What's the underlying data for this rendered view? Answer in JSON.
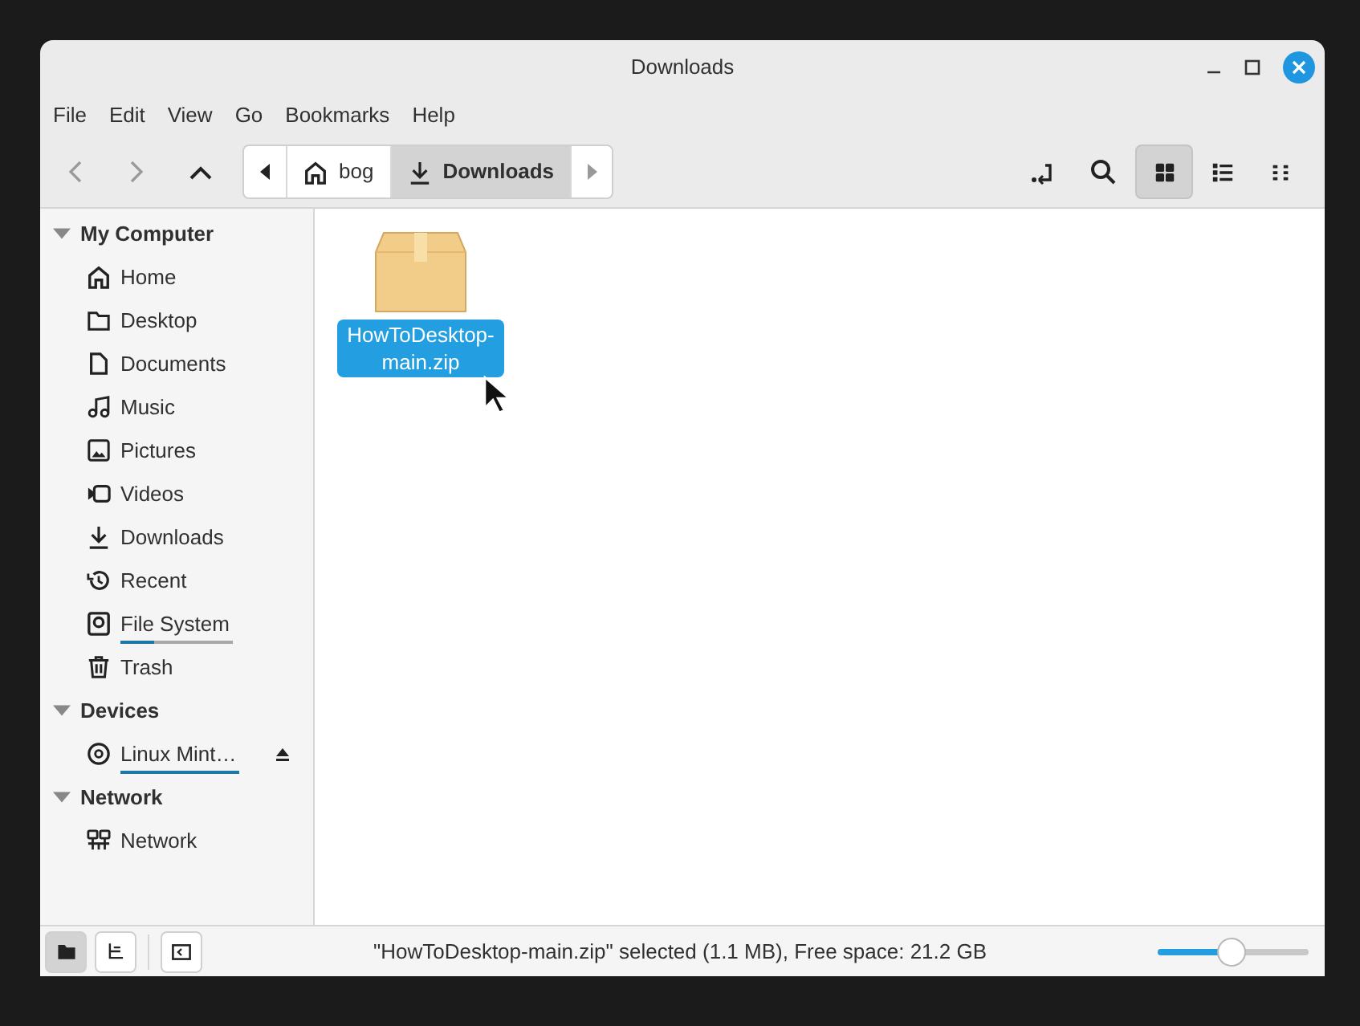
{
  "window": {
    "title": "Downloads"
  },
  "menu": [
    "File",
    "Edit",
    "View",
    "Go",
    "Bookmarks",
    "Help"
  ],
  "breadcrumbs": [
    {
      "label": "bog",
      "kind": "home",
      "selected": false
    },
    {
      "label": "Downloads",
      "kind": "download",
      "selected": true
    }
  ],
  "view_buttons": [
    {
      "kind": "grid",
      "selected": true
    },
    {
      "kind": "list",
      "selected": false
    },
    {
      "kind": "compact",
      "selected": false
    }
  ],
  "sidebar": [
    {
      "title": "My Computer",
      "expanded": true,
      "items": [
        {
          "label": "Home",
          "kind": "home"
        },
        {
          "label": "Desktop",
          "kind": "folder"
        },
        {
          "label": "Documents",
          "kind": "document"
        },
        {
          "label": "Music",
          "kind": "music"
        },
        {
          "label": "Pictures",
          "kind": "picture"
        },
        {
          "label": "Videos",
          "kind": "video"
        },
        {
          "label": "Downloads",
          "kind": "download"
        },
        {
          "label": "Recent",
          "kind": "recent"
        },
        {
          "label": "File System",
          "kind": "disk",
          "level": 0.3
        },
        {
          "label": "Trash",
          "kind": "trash"
        }
      ]
    },
    {
      "title": "Devices",
      "expanded": true,
      "items": [
        {
          "label": "Linux Mint…",
          "kind": "disc",
          "level": 1,
          "eject": true
        }
      ]
    },
    {
      "title": "Network",
      "expanded": true,
      "items": [
        {
          "label": "Network",
          "kind": "network"
        }
      ]
    }
  ],
  "files": [
    {
      "name": "HowToDesktop-main.zip",
      "selected": true
    }
  ],
  "status_bar": {
    "pane_buttons": [
      {
        "kind": "places",
        "selected": true
      },
      {
        "kind": "tree",
        "selected": false
      }
    ],
    "text": "\"HowToDesktop-main.zip\" selected (1.1 MB), Free space: 21.2 GB",
    "zoom": {
      "level": 0.49
    }
  }
}
